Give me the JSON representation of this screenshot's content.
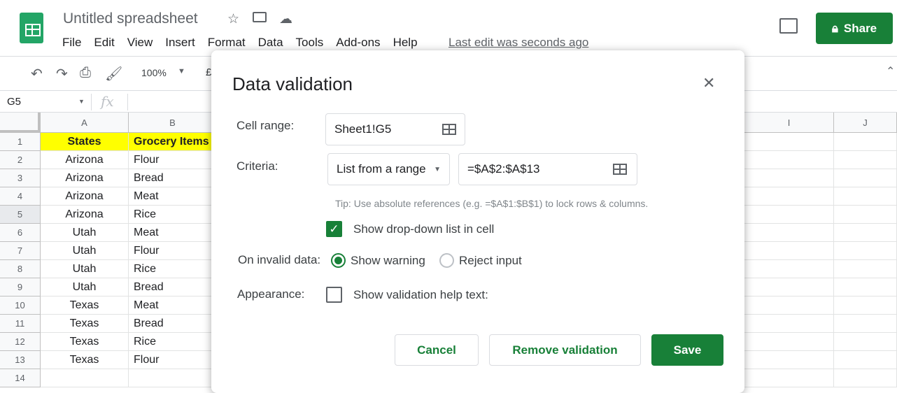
{
  "header": {
    "title": "Untitled spreadsheet",
    "menu": [
      "File",
      "Edit",
      "View",
      "Insert",
      "Format",
      "Data",
      "Tools",
      "Add-ons",
      "Help"
    ],
    "last_edit": "Last edit was seconds ago",
    "share": "Share"
  },
  "toolbar": {
    "zoom": "100%",
    "currency": "£"
  },
  "formula_bar": {
    "name_box": "G5",
    "fx": "fx"
  },
  "columns": [
    "A",
    "B",
    "I",
    "J"
  ],
  "rows": [
    {
      "n": "1",
      "a": "States",
      "b": "Grocery Items"
    },
    {
      "n": "2",
      "a": "Arizona",
      "b": "Flour"
    },
    {
      "n": "3",
      "a": "Arizona",
      "b": "Bread"
    },
    {
      "n": "4",
      "a": "Arizona",
      "b": "Meat"
    },
    {
      "n": "5",
      "a": "Arizona",
      "b": "Rice"
    },
    {
      "n": "6",
      "a": "Utah",
      "b": "Meat"
    },
    {
      "n": "7",
      "a": "Utah",
      "b": "Flour"
    },
    {
      "n": "8",
      "a": "Utah",
      "b": "Rice"
    },
    {
      "n": "9",
      "a": "Utah",
      "b": "Bread"
    },
    {
      "n": "10",
      "a": "Texas",
      "b": "Meat"
    },
    {
      "n": "11",
      "a": "Texas",
      "b": "Bread"
    },
    {
      "n": "12",
      "a": "Texas",
      "b": "Rice"
    },
    {
      "n": "13",
      "a": "Texas",
      "b": "Flour"
    },
    {
      "n": "14",
      "a": "",
      "b": ""
    }
  ],
  "dialog": {
    "title": "Data validation",
    "cell_range_label": "Cell range:",
    "cell_range": "Sheet1!G5",
    "criteria_label": "Criteria:",
    "criteria_type": "List from a range",
    "criteria_value": "=$A$2:$A$13",
    "tip": "Tip: Use absolute references (e.g. =$A$1:$B$1) to lock rows & columns.",
    "show_dropdown": "Show drop-down list in cell",
    "invalid_label": "On invalid data:",
    "show_warning": "Show warning",
    "reject_input": "Reject input",
    "appearance_label": "Appearance:",
    "help_text": "Show validation help text:",
    "cancel": "Cancel",
    "remove": "Remove validation",
    "save": "Save"
  },
  "colors": {
    "accent": "#188038",
    "header_fill": "#ffff00"
  }
}
